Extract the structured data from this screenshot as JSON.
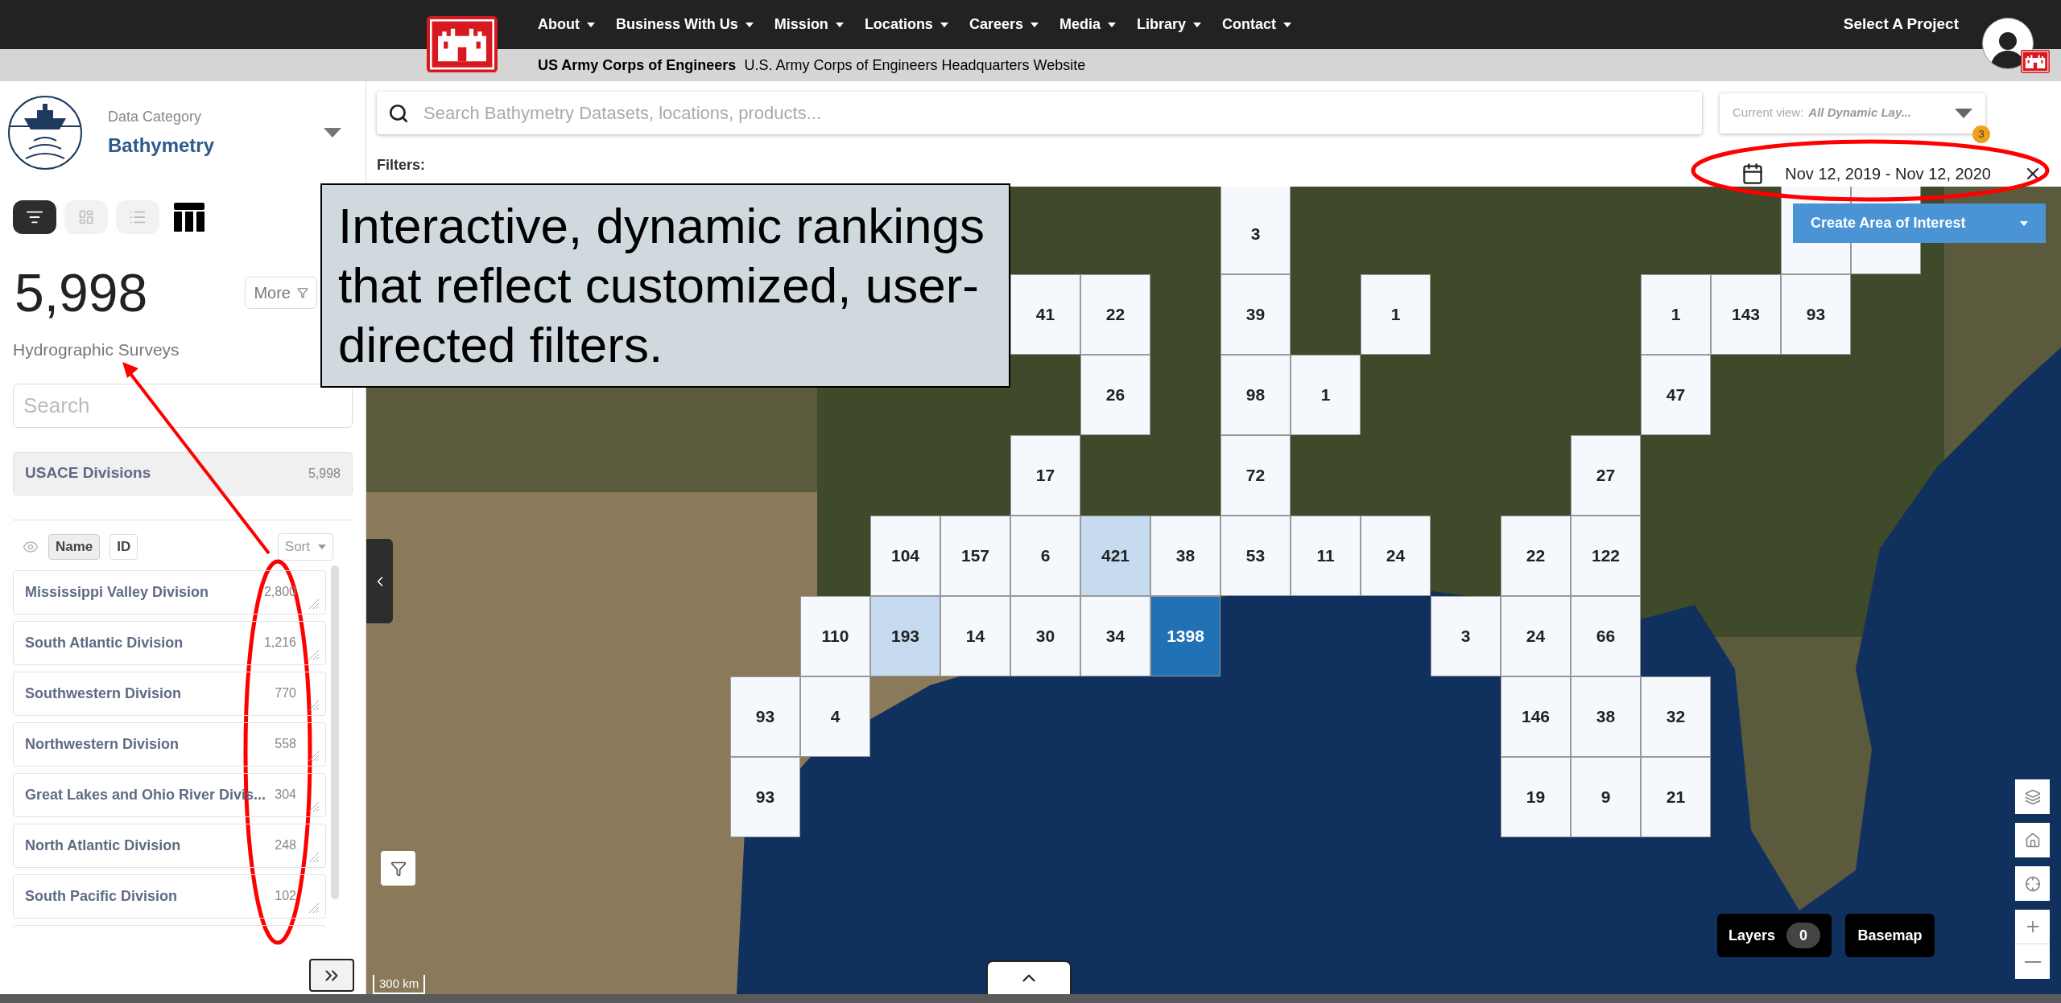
{
  "header": {
    "nav": [
      "About",
      "Business With Us",
      "Mission",
      "Locations",
      "Careers",
      "Media",
      "Library",
      "Contact"
    ],
    "org_name": "US Army Corps of Engineers",
    "site_title": "U.S. Army Corps of Engineers Headquarters Website",
    "project_button": "Select A Project"
  },
  "sidebar": {
    "category_label": "Data Category",
    "category": "Bathymetry",
    "views": [
      {
        "kind": "filter",
        "selected": true
      },
      {
        "kind": "grid",
        "selected": false
      },
      {
        "kind": "list",
        "selected": false
      },
      {
        "kind": "table",
        "selected": false
      }
    ],
    "total": "5,998",
    "more_button": "More",
    "total_label": "Hydrographic Surveys",
    "search": {
      "placeholder": "Search"
    },
    "group": {
      "label": "USACE Divisions",
      "count": "5,998"
    },
    "sort_tabs": [
      {
        "label": "Name",
        "selected": true
      },
      {
        "label": "ID",
        "selected": false
      }
    ],
    "sort": "Sort",
    "items": [
      {
        "name": "Mississippi Valley Division",
        "count": "2,800"
      },
      {
        "name": "South Atlantic Division",
        "count": "1,216"
      },
      {
        "name": "Southwestern Division",
        "count": "770"
      },
      {
        "name": "Northwestern Division",
        "count": "558"
      },
      {
        "name": "Great Lakes and Ohio River Divis...",
        "count": "304"
      },
      {
        "name": "North Atlantic Division",
        "count": "248"
      },
      {
        "name": "South Pacific Division",
        "count": "102"
      }
    ]
  },
  "search": {
    "placeholder": "Search Bathymetry Datasets, locations, products..."
  },
  "current_view": {
    "label": "Current view:",
    "value": "All Dynamic Lay...",
    "badge": "3"
  },
  "filters_label": "Filters:",
  "date_range": "Nov 12, 2019 - Nov 12, 2020",
  "aoi_button": "Create Area of Interest",
  "grid_cells": [
    {
      "color": "#f5f9fd"
    },
    {
      "color": "#f5f9fd"
    },
    {
      "value": "3",
      "color": "#f5f9fd"
    },
    {
      "value": "41",
      "color": "#f5f9fd"
    },
    {
      "value": "22",
      "color": "#f5f9fd"
    },
    {
      "value": "39",
      "color": "#f5f9fd"
    },
    {
      "value": "1",
      "color": "#f5f9fd"
    },
    {
      "value": "1",
      "color": "#f5f9fd"
    },
    {
      "value": "143",
      "color": "#f5f9fd"
    },
    {
      "value": "93",
      "color": "#f5f9fd"
    },
    {
      "value": "26",
      "color": "#f5f9fd"
    },
    {
      "value": "98",
      "color": "#f5f9fd"
    },
    {
      "value": "1",
      "color": "#f5f9fd"
    },
    {
      "value": "47",
      "color": "#f5f9fd"
    },
    {
      "value": "17",
      "color": "#f5f9fd"
    },
    {
      "value": "72",
      "color": "#f5f9fd"
    },
    {
      "value": "27",
      "color": "#f5f9fd"
    },
    {
      "value": "104",
      "color": "#f5f9fd"
    },
    {
      "value": "157",
      "color": "#f5f9fd"
    },
    {
      "value": "6",
      "color": "#f5f9fd"
    },
    {
      "value": "421",
      "color": "#c6dbef"
    },
    {
      "value": "38",
      "color": "#f5f9fd"
    },
    {
      "value": "53",
      "color": "#f5f9fd"
    },
    {
      "value": "11",
      "color": "#f5f9fd"
    },
    {
      "value": "24",
      "color": "#f5f9fd"
    },
    {
      "value": "22",
      "color": "#f5f9fd"
    },
    {
      "value": "122",
      "color": "#f5f9fd"
    },
    {
      "value": "110",
      "color": "#f5f9fd"
    },
    {
      "value": "193",
      "color": "#c6dbef"
    },
    {
      "value": "14",
      "color": "#f5f9fd"
    },
    {
      "value": "30",
      "color": "#f5f9fd"
    },
    {
      "value": "34",
      "color": "#f5f9fd"
    },
    {
      "value": "1398",
      "color": "#2171b5"
    },
    {
      "value": "3",
      "color": "#f5f9fd"
    },
    {
      "value": "24",
      "color": "#f5f9fd"
    },
    {
      "value": "66",
      "color": "#f5f9fd"
    },
    {
      "value": "93",
      "color": "#f5f9fd"
    },
    {
      "value": "4",
      "color": "#f5f9fd"
    },
    {
      "value": "146",
      "color": "#f5f9fd"
    },
    {
      "value": "38",
      "color": "#f5f9fd"
    },
    {
      "value": "32",
      "color": "#f5f9fd"
    },
    {
      "value": "93",
      "color": "#f5f9fd"
    },
    {
      "value": "19",
      "color": "#f5f9fd"
    },
    {
      "value": "9",
      "color": "#f5f9fd"
    },
    {
      "value": "21",
      "color": "#f5f9fd"
    }
  ],
  "map_controls": {
    "layers_button": "Layers",
    "layers_count": "0",
    "basemap_button": "Basemap",
    "scale": "300 km"
  },
  "callout": "Interactive, dynamic rankings that reflect customized, user-directed filters."
}
